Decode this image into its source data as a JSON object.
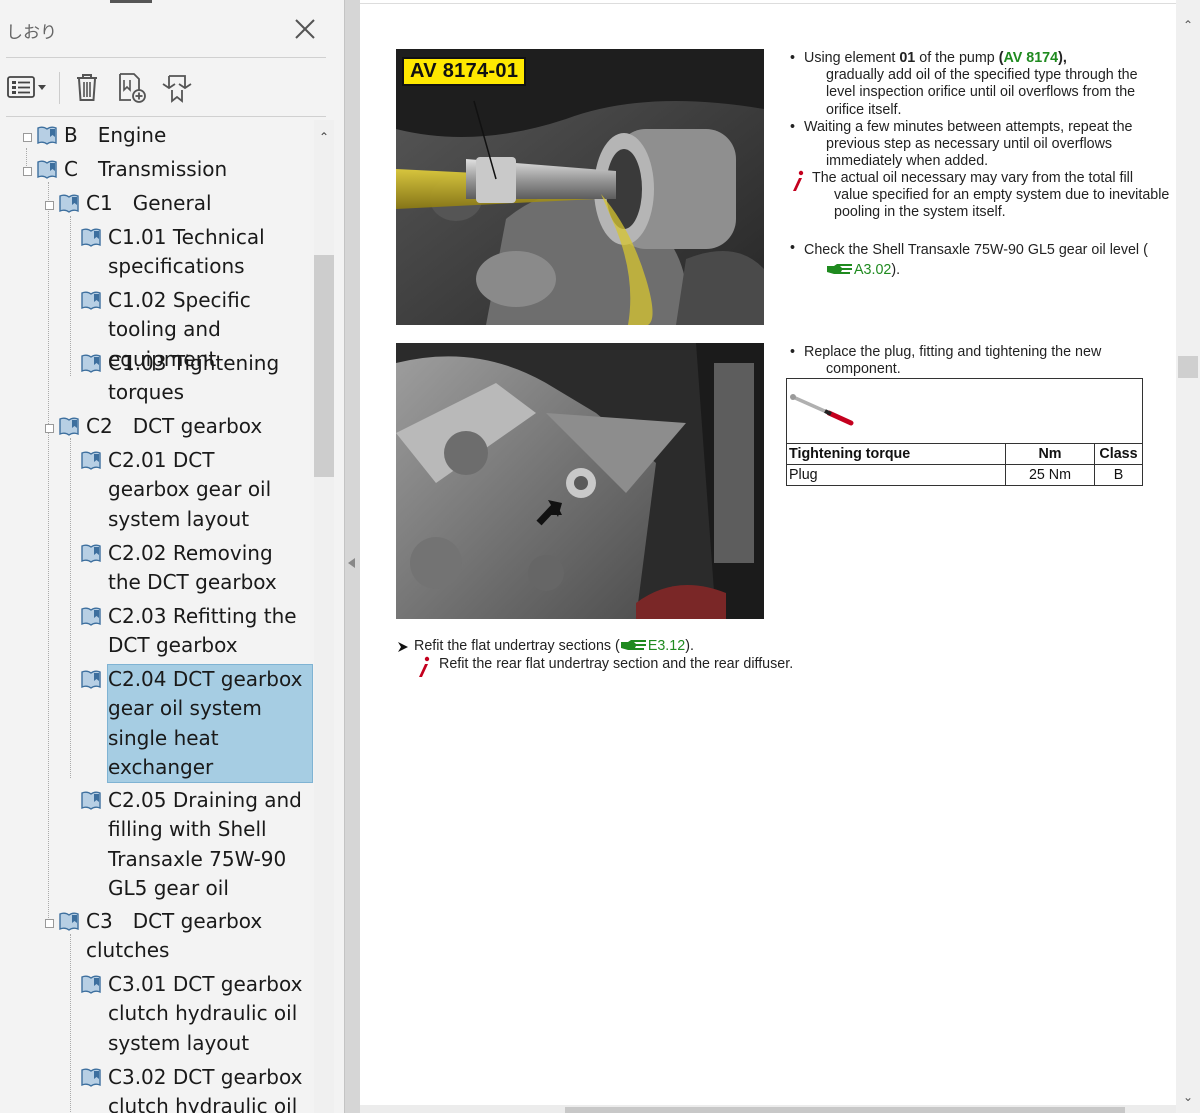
{
  "sidebar": {
    "title": "しおり",
    "toolbar_icons": [
      "options-menu-icon",
      "delete-icon",
      "new-bookmark-icon",
      "expand-bookmark-icon"
    ],
    "items": [
      {
        "text": "B Engine"
      },
      {
        "text": "C Transmission"
      },
      {
        "text": "C1 General"
      },
      {
        "text": "C1.01 Technical specifications"
      },
      {
        "text": "C1.02 Specific tooling and equipment"
      },
      {
        "text": "C1.03 Tightening torques"
      },
      {
        "text": "C2 DCT gearbox"
      },
      {
        "text": "C2.01 DCT gearbox gear oil system layout"
      },
      {
        "text": "C2.02 Removing the DCT gearbox"
      },
      {
        "text": "C2.03 Refitting the DCT gearbox"
      },
      {
        "text": "C2.04 DCT gearbox gear oil system single heat exchanger"
      },
      {
        "text": "C2.05 Draining and filling with Shell Transaxle 75W-90 GL5 gear oil"
      },
      {
        "text": "C3 DCT gearbox clutches"
      },
      {
        "text": "C3.01 DCT gearbox clutch hydraulic oil system layout"
      },
      {
        "text": "C3.02 DCT gearbox clutch hydraulic oil"
      }
    ]
  },
  "document": {
    "photo1_tag": "AV 8174-01",
    "step1": {
      "a": "Using element ",
      "b": "01",
      "c": " of the pump ",
      "d": "(",
      "e": "AV 8174",
      "f": "),",
      "g": "gradually add oil of the specified type through the level inspection orifice until oil overflows from the orifice itself."
    },
    "step2": "Waiting a few minutes between attempts, repeat the previous step as necessary until oil overflows immediately when added.",
    "note1": "The actual oil necessary may vary from the total fill value specified for an empty system due to inevitable pooling in the system itself.",
    "step3": {
      "a": "Check the Shell Transaxle 75W-90 GL5 gear oil level (",
      "ref": "A3.02",
      "b": ")."
    },
    "step4": "Replace the plug, fitting and tightening the new component.",
    "table": {
      "headers": [
        "Tightening torque",
        "Nm",
        "Class"
      ],
      "row": [
        "Plug",
        "25 Nm",
        "B"
      ]
    },
    "step5": {
      "a": "Refit the flat undertray sections (",
      "ref": "E3.12",
      "b": ")."
    },
    "note2": "Refit the rear flat undertray section and the rear diffuser."
  },
  "colors": {
    "link_green": "#1f8a1f",
    "selection": "#a6cde3",
    "tag_yellow": "#ffe800"
  }
}
